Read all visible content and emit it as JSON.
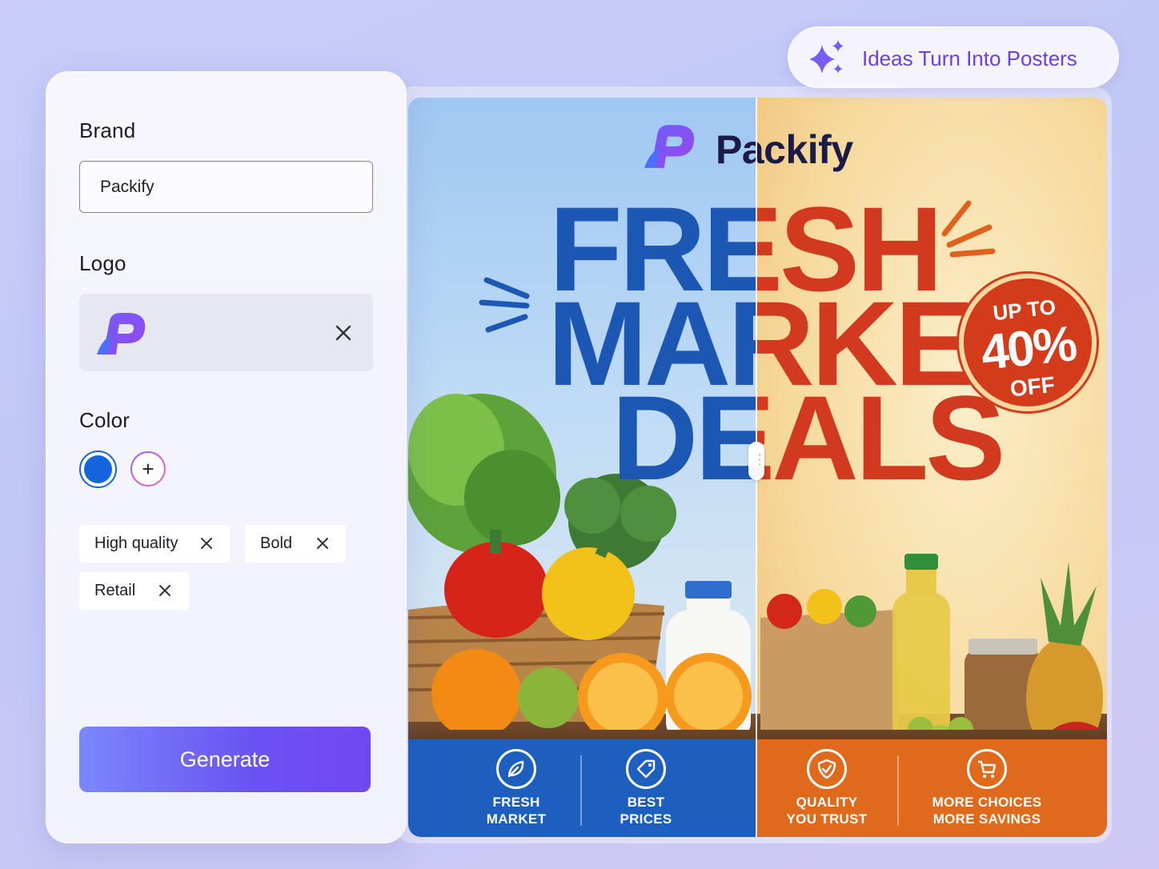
{
  "panel": {
    "brand_label": "Brand",
    "brand_value": "Packify",
    "logo_label": "Logo",
    "color_label": "Color",
    "selected_color": "#1464dd",
    "add_color_symbol": "+",
    "tags": [
      "High quality",
      "Bold",
      "Retail"
    ],
    "generate_label": "Generate"
  },
  "badge": {
    "icon": "sparkles-icon",
    "text": "Ideas Turn Into Posters"
  },
  "poster": {
    "brand_name": "Packify",
    "headline": [
      "FRESH",
      "MARKET",
      "DEALS"
    ],
    "stamp": {
      "top": "UP TO",
      "value": "40%",
      "bottom": "OFF"
    },
    "features": [
      {
        "icon": "leaf-icon",
        "line1": "FRESH",
        "line2": "MARKET"
      },
      {
        "icon": "price-tag-icon",
        "line1": "BEST",
        "line2": "PRICES"
      },
      {
        "icon": "shield-check-icon",
        "line1": "QUALITY",
        "line2": "YOU TRUST"
      },
      {
        "icon": "cart-icon",
        "line1": "MORE CHOICES",
        "line2": "MORE SAVINGS"
      }
    ],
    "colors": {
      "blue": "#1b57b3",
      "red": "#d23a1f",
      "orange": "#e06a1c"
    }
  }
}
